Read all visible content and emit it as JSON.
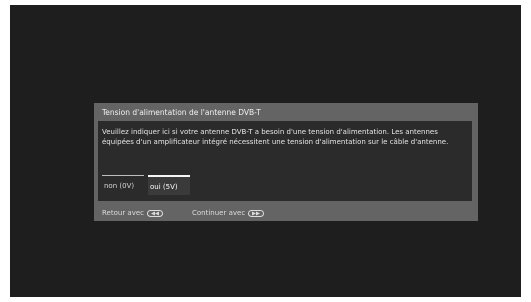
{
  "dialog": {
    "title": "Tension d'alimentation de l'antenne DVB-T",
    "message": "Veuillez indiquer ici si votre antenne DVB-T a besoin d'une tension d'alimentation. Les antennes équipées d'un amplificateur intégré nécessitent une tension d'alimentation sur le câble d'antenne.",
    "options": [
      {
        "label": "non (0V)",
        "selected": false
      },
      {
        "label": "oui (5V)",
        "selected": true
      }
    ]
  },
  "footer": {
    "back_label": "Retour avec",
    "back_icon": "rewind-button-icon",
    "continue_label": "Continuer avec",
    "continue_icon": "fast-forward-button-icon"
  }
}
